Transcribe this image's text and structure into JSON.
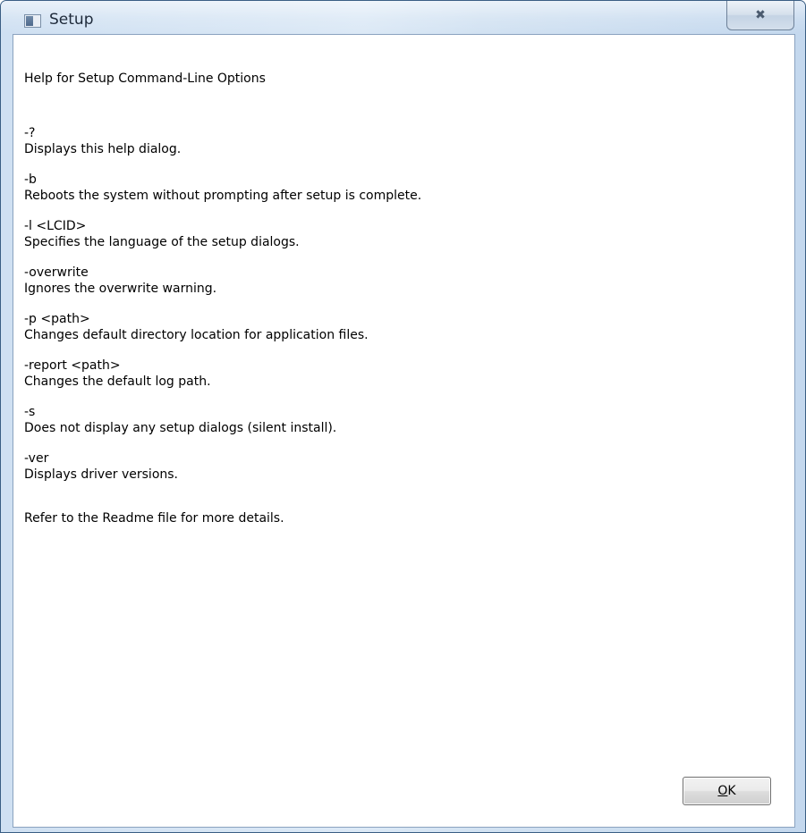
{
  "window": {
    "title": "Setup",
    "close_glyph": "✖"
  },
  "dialog": {
    "heading": "Help for Setup Command-Line Options",
    "options": [
      {
        "switch": "-?",
        "description": "Displays this help dialog."
      },
      {
        "switch": "-b",
        "description": "Reboots the system without prompting after setup is complete."
      },
      {
        "switch": "-l <LCID>",
        "description": "Specifies the language of the setup dialogs."
      },
      {
        "switch": "-overwrite",
        "description": "Ignores the overwrite warning."
      },
      {
        "switch": "-p <path>",
        "description": "Changes default directory location for application files."
      },
      {
        "switch": "-report <path>",
        "description": "Changes the default log path."
      },
      {
        "switch": "-s",
        "description": "Does not display any setup dialogs (silent install)."
      },
      {
        "switch": "-ver",
        "description": "Displays driver versions."
      }
    ],
    "footer_note": "Refer to the Readme file for more details."
  },
  "buttons": {
    "ok_mnemonic": "O",
    "ok_rest": "K"
  },
  "icons": {
    "app": "setup-window-icon",
    "close": "close-icon"
  },
  "colors": {
    "titlebar": "#cfe0f2",
    "frame_border": "#3a5e84",
    "client_bg": "#ffffff"
  }
}
